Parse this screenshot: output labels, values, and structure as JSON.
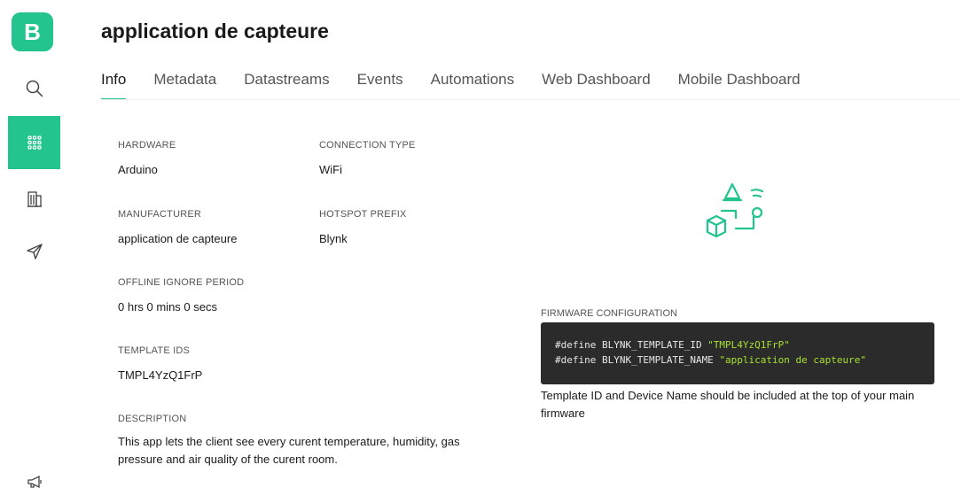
{
  "sidebar": {
    "logo_letter": "B",
    "items": [
      {
        "icon": "search-icon"
      },
      {
        "icon": "templates-grid-icon",
        "active": true
      },
      {
        "icon": "organizations-building-icon"
      },
      {
        "icon": "send-plane-icon"
      },
      {
        "icon": "megaphone-icon"
      }
    ]
  },
  "header": {
    "title": "application de capteure"
  },
  "tabs": [
    {
      "label": "Info",
      "active": true
    },
    {
      "label": "Metadata"
    },
    {
      "label": "Datastreams"
    },
    {
      "label": "Events"
    },
    {
      "label": "Automations"
    },
    {
      "label": "Web Dashboard"
    },
    {
      "label": "Mobile Dashboard"
    }
  ],
  "info": {
    "hardware": {
      "label": "HARDWARE",
      "value": "Arduino"
    },
    "connection_type": {
      "label": "CONNECTION TYPE",
      "value": "WiFi"
    },
    "manufacturer": {
      "label": "MANUFACTURER",
      "value": "application de capteure"
    },
    "hotspot_prefix": {
      "label": "HOTSPOT PREFIX",
      "value": "Blynk"
    },
    "offline_ignore_period": {
      "label": "OFFLINE IGNORE PERIOD",
      "value": "0 hrs 0 mins 0 secs"
    },
    "template_ids": {
      "label": "TEMPLATE IDS",
      "value": "TMPL4YzQ1FrP"
    },
    "description": {
      "label": "DESCRIPTION",
      "value": "This app lets the client see every curent temperature, humidity, gas pressure and air quality of the curent room."
    }
  },
  "firmware": {
    "label": "FIRMWARE CONFIGURATION",
    "line1_prefix": "#define BLYNK_TEMPLATE_ID ",
    "line1_value": "\"TMPL4YzQ1FrP\"",
    "line2_prefix": "#define BLYNK_TEMPLATE_NAME ",
    "line2_value": "\"application de capteure\"",
    "note": "Template ID and Device Name should be included at the top of your main firmware"
  },
  "colors": {
    "accent": "#23c48e",
    "code_bg": "#2b2b2b",
    "code_string": "#a6e22e"
  }
}
